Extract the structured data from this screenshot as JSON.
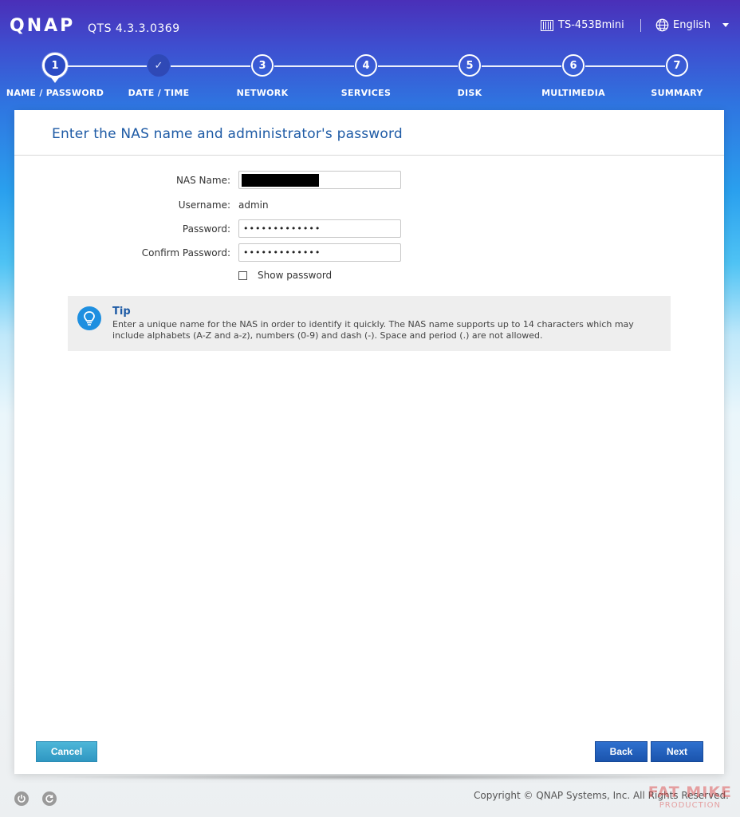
{
  "header": {
    "logo": "QNAP",
    "version": "QTS 4.3.3.0369",
    "device": "TS-453Bmini",
    "language": "English"
  },
  "steps": [
    {
      "number": "1",
      "label": "NAME / PASSWORD",
      "state": "active"
    },
    {
      "number": "✓",
      "label": "DATE / TIME",
      "state": "done"
    },
    {
      "number": "3",
      "label": "NETWORK",
      "state": "pending"
    },
    {
      "number": "4",
      "label": "SERVICES",
      "state": "pending"
    },
    {
      "number": "5",
      "label": "DISK",
      "state": "pending"
    },
    {
      "number": "6",
      "label": "MULTIMEDIA",
      "state": "pending"
    },
    {
      "number": "7",
      "label": "SUMMARY",
      "state": "pending"
    }
  ],
  "panel": {
    "title": "Enter the NAS name and administrator's password"
  },
  "form": {
    "nas_name_label": "NAS Name:",
    "username_label": "Username:",
    "username_value": "admin",
    "password_label": "Password:",
    "password_value": "•••••••••••••",
    "confirm_label": "Confirm Password:",
    "confirm_value": "•••••••••••••",
    "show_password_label": "Show password",
    "show_password_checked": false
  },
  "tip": {
    "title": "Tip",
    "text": "Enter a unique name for the NAS in order to identify it quickly. The NAS name supports up to 14 characters which may include alphabets (A-Z and a-z), numbers (0-9) and dash (-). Space and period (.) are not allowed."
  },
  "buttons": {
    "cancel": "Cancel",
    "back": "Back",
    "next": "Next"
  },
  "footer": {
    "copyright": "Copyright © QNAP Systems, Inc. All Rights Reserved."
  },
  "watermark": {
    "line1": "FAT MIKE",
    "line2": "PRODUCTION"
  },
  "colors": {
    "accent": "#1d5aa5",
    "button_primary": "#1b54ad",
    "button_cancel": "#2f97c2",
    "tip_icon": "#1e8fe0"
  }
}
